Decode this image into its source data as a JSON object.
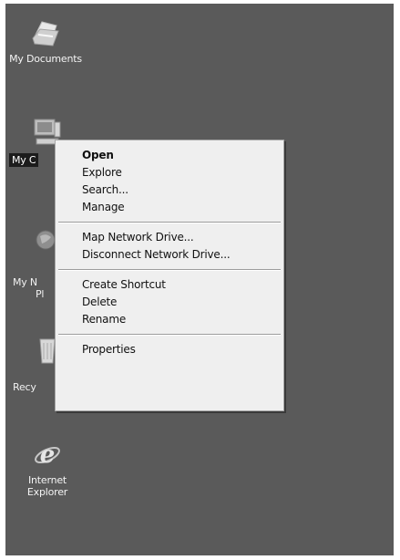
{
  "desktop": {
    "icons": [
      {
        "id": "my-documents",
        "label": "My Documents",
        "icon": "folder-documents-icon"
      },
      {
        "id": "my-computer",
        "label": "My Computer",
        "visible_label": "My C",
        "icon": "computer-icon",
        "selected": true
      },
      {
        "id": "my-network-places",
        "label_line1": "My N",
        "label_line2": "Pl",
        "icon": "network-places-icon"
      },
      {
        "id": "recycle-bin",
        "label": "Recy",
        "icon": "recycle-bin-icon"
      },
      {
        "id": "internet-explorer",
        "label": "Internet\nExplorer",
        "icon": "internet-explorer-icon"
      }
    ]
  },
  "context_menu": {
    "groups": [
      [
        "Open",
        "Explore",
        "Search...",
        "Manage"
      ],
      [
        "Map Network Drive...",
        "Disconnect Network Drive..."
      ],
      [
        "Create Shortcut",
        "Delete",
        "Rename"
      ],
      [
        "Properties"
      ]
    ],
    "default_item": "Open"
  },
  "colors": {
    "desktop_bg": "#5a5a5a",
    "menu_bg": "#efefef",
    "text": "#111111"
  }
}
